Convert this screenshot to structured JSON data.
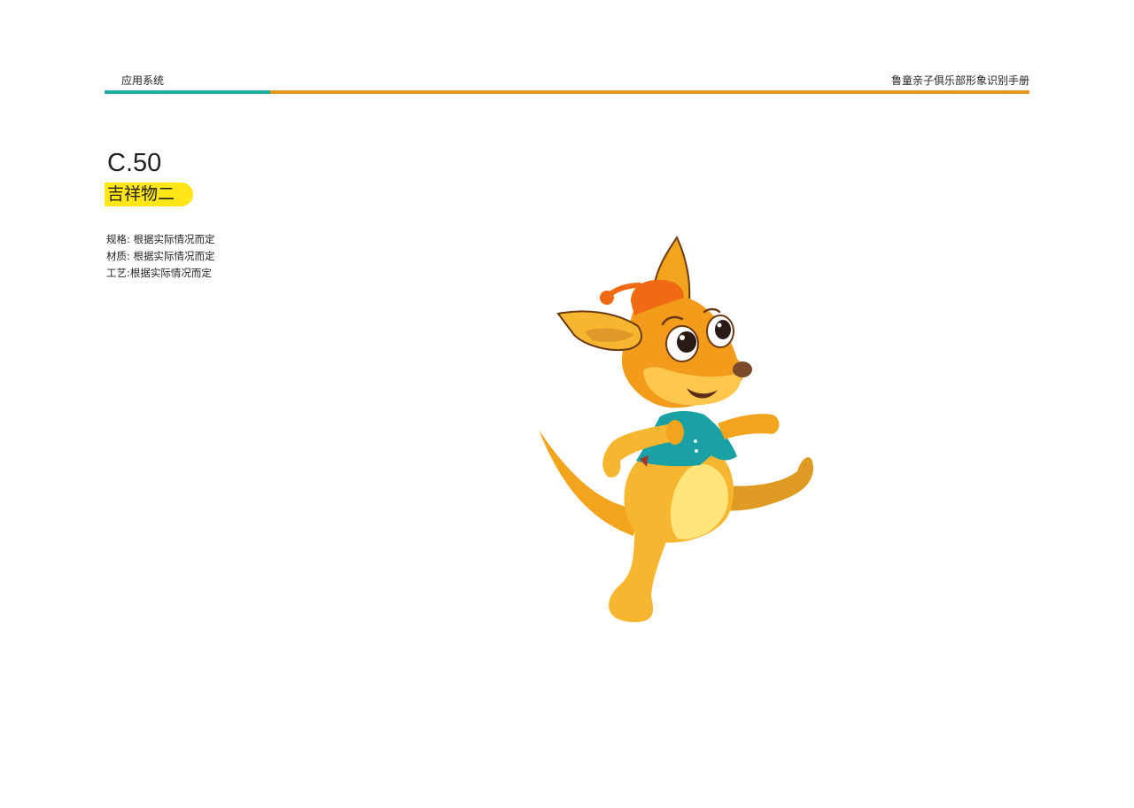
{
  "header": {
    "section": "应用系统",
    "manual_title": "鲁童亲子俱乐部形象识别手册"
  },
  "colors": {
    "teal": "#1fae9f",
    "orange": "#e6951e",
    "highlight": "#ffe617"
  },
  "page": {
    "code": "C.50",
    "title": "吉祥物二"
  },
  "specs": [
    {
      "text": "规格: 根据实际情况而定"
    },
    {
      "text": "材质: 根据实际情况而定"
    },
    {
      "text": "工艺:根据实际情况而定"
    }
  ],
  "mascot": {
    "icon": "kangaroo-mascot-illustration"
  }
}
